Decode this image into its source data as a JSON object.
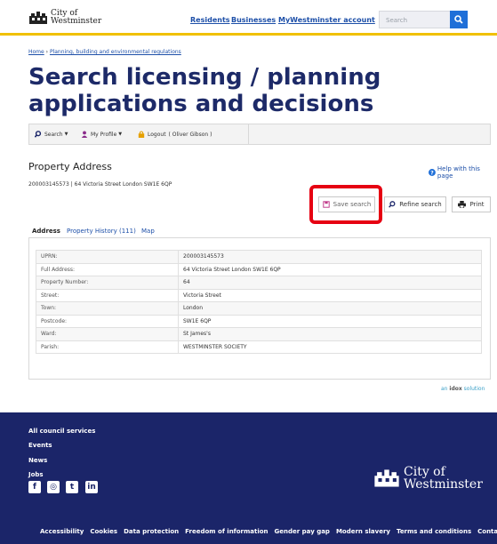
{
  "header": {
    "logo_line1": "City of",
    "logo_line2": "Westminster",
    "nav": [
      "Residents",
      "Businesses",
      "MyWestminster account"
    ],
    "search_placeholder": "Search"
  },
  "breadcrumb": {
    "home": "Home",
    "sep": " › ",
    "current": "Planning, building and environmental regulations"
  },
  "page_title": "Search licensing / planning applications and decisions",
  "toolbar": {
    "search": "Search",
    "profile": "My Profile",
    "logout": "Logout",
    "user": "( Oliver Gibson )"
  },
  "property": {
    "title": "Property Address",
    "subtitle": "200003145573 | 64 Victoria Street London SW1E 6QP",
    "help": "Help with this page"
  },
  "actions": {
    "save": "Save search",
    "refine": "Refine search",
    "print": "Print"
  },
  "tabs": [
    "Address",
    "Property History (111)",
    "Map"
  ],
  "details": [
    {
      "label": "UPRN:",
      "value": "200003145573"
    },
    {
      "label": "Full Address:",
      "value": "64 Victoria Street London SW1E 6QP"
    },
    {
      "label": "Property Number:",
      "value": "64"
    },
    {
      "label": "Street:",
      "value": "Victoria Street"
    },
    {
      "label": "Town:",
      "value": "London"
    },
    {
      "label": "Postcode:",
      "value": "SW1E 6QP"
    },
    {
      "label": "Ward:",
      "value": "St James's"
    },
    {
      "label": "Parish:",
      "value": "WESTMINSTER SOCIETY"
    }
  ],
  "idox": {
    "pre": "an ",
    "brand": "idox",
    "post": " solution"
  },
  "footer": {
    "links": [
      "All council services",
      "Events",
      "News",
      "Jobs"
    ],
    "logo_line1": "City of",
    "logo_line2": "Westminster",
    "social": [
      "f",
      "◎",
      "t",
      "in"
    ],
    "bottom_links": [
      "Accessibility",
      "Cookies",
      "Data protection",
      "Freedom of information",
      "Gender pay gap",
      "Modern slavery",
      "Terms and conditions",
      "Contact us"
    ]
  },
  "colors": {
    "brand_navy": "#1b2569",
    "link_blue": "#1d4fa8",
    "accent_yellow": "#f0c000",
    "highlight_red": "#e60012"
  }
}
